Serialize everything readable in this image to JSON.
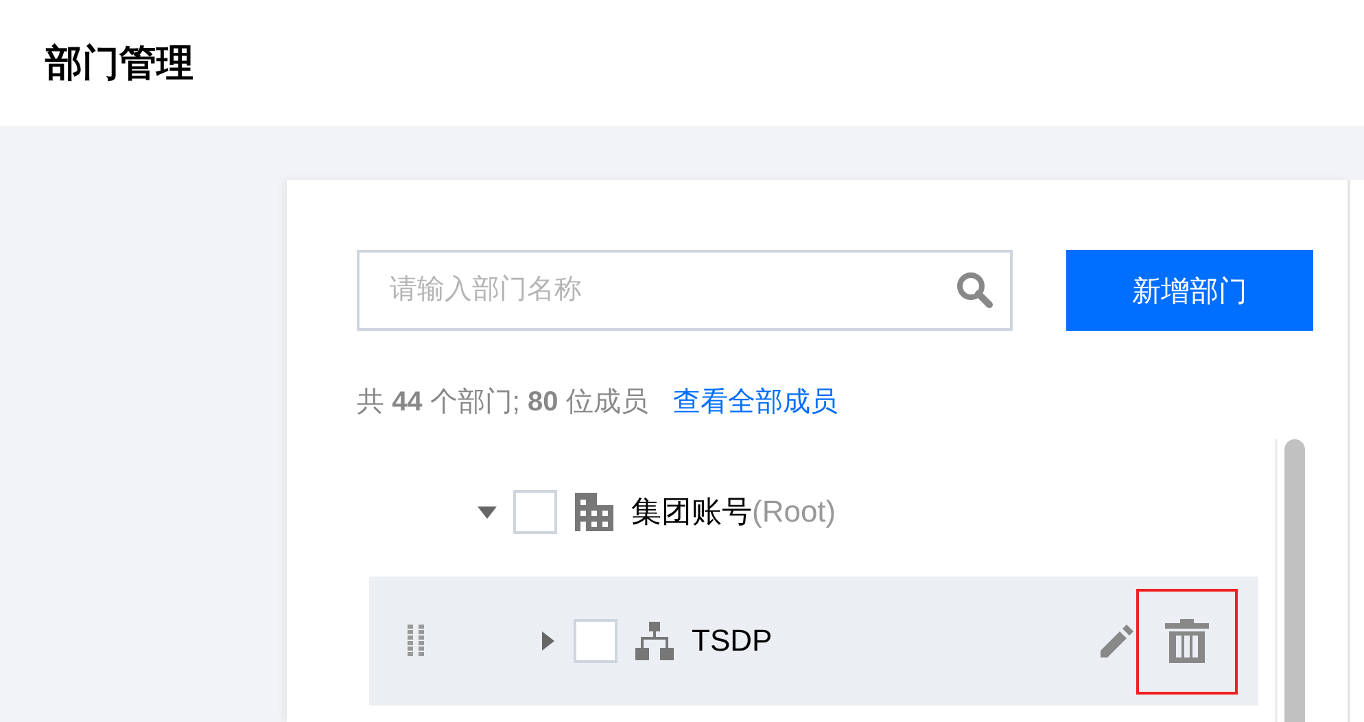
{
  "page_title": "部门管理",
  "search": {
    "placeholder": "请输入部门名称"
  },
  "add_button": "新增部门",
  "summary": {
    "text": "共 **44** 个部门; **80** 位成员",
    "link": "查看全部成员"
  },
  "tree": [
    {
      "name": "集团账号",
      "tag": "(Root)",
      "kind": "company",
      "expanded": true,
      "checked": false,
      "selected": false,
      "children": [
        {
          "name": "TSDP",
          "kind": "department",
          "expanded": false,
          "checked": false,
          "selected": true
        }
      ]
    }
  ]
}
